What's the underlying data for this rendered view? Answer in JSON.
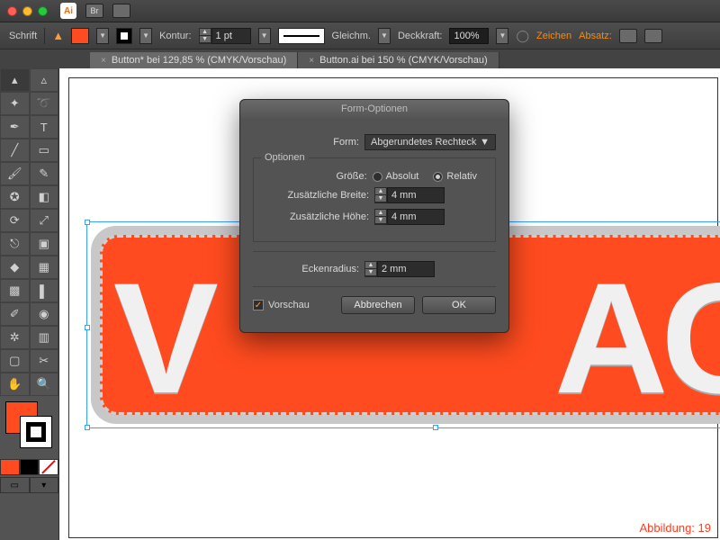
{
  "titlebar": {
    "app_label": "Ai",
    "br_label": "Br"
  },
  "menu": {
    "schrift": "Schrift"
  },
  "optbar": {
    "kontur": "Kontur:",
    "stroke_weight": "1 pt",
    "profile_label": "Gleichm.",
    "deckkraft": "Deckkraft:",
    "opacity": "100%",
    "zeichen": "Zeichen",
    "absatz": "Absatz:"
  },
  "tabs": [
    {
      "label": "Button* bei 129,85 % (CMYK/Vorschau)"
    },
    {
      "label": "Button.ai bei 150 % (CMYK/Vorschau)"
    }
  ],
  "canvas": {
    "letters_left": "V",
    "letters_right": "AG",
    "caption": "Abbildung: 19"
  },
  "dialog": {
    "title": "Form-Optionen",
    "form_label": "Form:",
    "form_value": "Abgerundetes Rechteck",
    "optionen": "Optionen",
    "groesse": "Größe:",
    "absolut": "Absolut",
    "relativ": "Relativ",
    "extra_width_label": "Zusätzliche Breite:",
    "extra_width": "4 mm",
    "extra_height_label": "Zusätzliche Höhe:",
    "extra_height": "4 mm",
    "corner_label": "Eckenradius:",
    "corner": "2 mm",
    "vorschau": "Vorschau",
    "cancel": "Abbrechen",
    "ok": "OK"
  },
  "colors": {
    "accent": "#ff4b1f"
  }
}
